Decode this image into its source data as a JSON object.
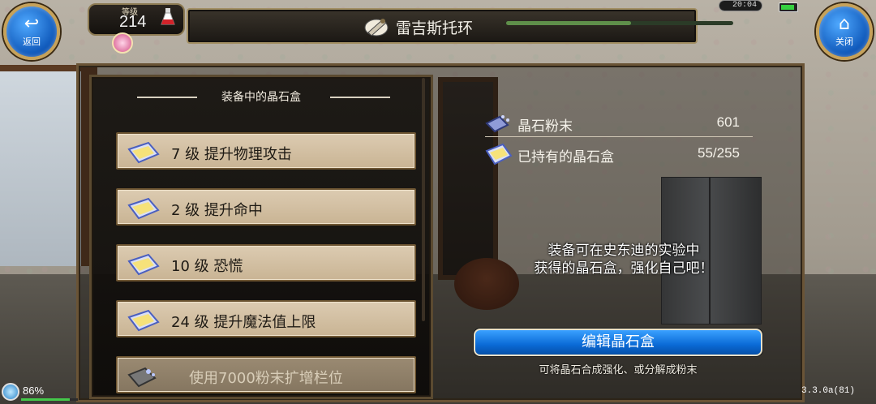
{
  "app": {
    "title": "雷吉斯托环"
  },
  "player": {
    "level_label": "等级",
    "level_value": "214"
  },
  "status": {
    "time": "20:04",
    "experience_fraction": 0.55,
    "bottom_percent": "86%",
    "bottom_fraction": 0.86,
    "version": "3.3.0a(81)"
  },
  "nav": {
    "back_label": "返回",
    "close_label": "关闭"
  },
  "left_panel": {
    "header": "装备中的晶石盒",
    "slots": [
      {
        "text": "7 级 提升物理攻击"
      },
      {
        "text": "2 级 提升命中"
      },
      {
        "text": "10 级 恐慌"
      },
      {
        "text": "24 级 提升魔法值上限"
      },
      {
        "text": "使用7000粉末扩增栏位"
      }
    ]
  },
  "right_panel": {
    "rows": [
      {
        "label": "晶石粉末",
        "value": "601"
      },
      {
        "label": "已持有的晶石盒",
        "value": "55/255"
      }
    ],
    "description_line1": "装备可在史东迪的实验中",
    "description_line2": "获得的晶石盒，强化自己吧！",
    "edit_button_label": "编辑晶石盒",
    "edit_hint": "可将晶石合成强化、或分解成粉末"
  },
  "colors": {
    "accent_blue": "#0a6ad6",
    "gold_border": "#c6a25b",
    "slot_bg": "#dccbb1"
  }
}
